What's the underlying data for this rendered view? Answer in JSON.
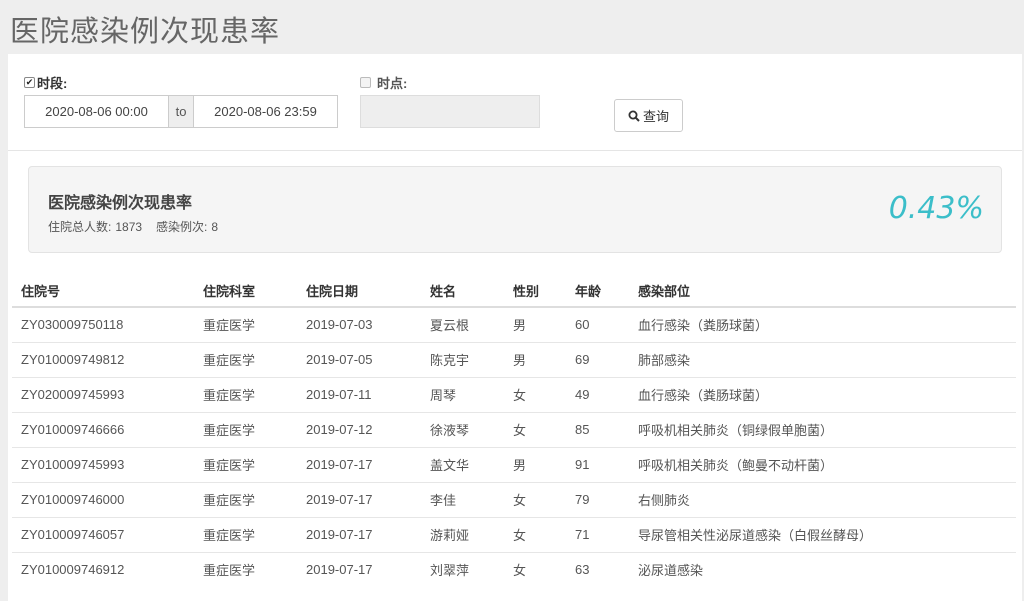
{
  "header": {
    "title": "医院感染例次现患率"
  },
  "filters": {
    "period_label": "时段:",
    "period_checked": true,
    "start": "2020-08-06 00:00",
    "to_label": "to",
    "end": "2020-08-06 23:59",
    "timepoint_label": "时点:",
    "timepoint_checked": false,
    "timepoint_value": "",
    "search_label": "查询"
  },
  "summary": {
    "title": "医院感染例次现患率",
    "total_label": "住院总人数:",
    "total_value": "1873",
    "cases_label": "感染例次:",
    "cases_value": "8",
    "rate": "0.43%",
    "rate_color": "#3bbec9"
  },
  "table": {
    "headers": [
      "住院号",
      "住院科室",
      "住院日期",
      "姓名",
      "性别",
      "年龄",
      "感染部位"
    ],
    "rows": [
      [
        "ZY030009750118",
        "重症医学",
        "2019-07-03",
        "夏云根",
        "男",
        "60",
        "血行感染（粪肠球菌）"
      ],
      [
        "ZY010009749812",
        "重症医学",
        "2019-07-05",
        "陈克宇",
        "男",
        "69",
        "肺部感染"
      ],
      [
        "ZY020009745993",
        "重症医学",
        "2019-07-11",
        "周琴",
        "女",
        "49",
        "血行感染（粪肠球菌）"
      ],
      [
        "ZY010009746666",
        "重症医学",
        "2019-07-12",
        "徐液琴",
        "女",
        "85",
        "呼吸机相关肺炎（铜绿假单胞菌）"
      ],
      [
        "ZY010009745993",
        "重症医学",
        "2019-07-17",
        "盖文华",
        "男",
        "91",
        "呼吸机相关肺炎（鲍曼不动杆菌）"
      ],
      [
        "ZY010009746000",
        "重症医学",
        "2019-07-17",
        "李佳",
        "女",
        "79",
        "右侧肺炎"
      ],
      [
        "ZY010009746057",
        "重症医学",
        "2019-07-17",
        "游莉娅",
        "女",
        "71",
        "导尿管相关性泌尿道感染（白假丝酵母）"
      ],
      [
        "ZY010009746912",
        "重症医学",
        "2019-07-17",
        "刘翠萍",
        "女",
        "63",
        "泌尿道感染"
      ]
    ]
  }
}
